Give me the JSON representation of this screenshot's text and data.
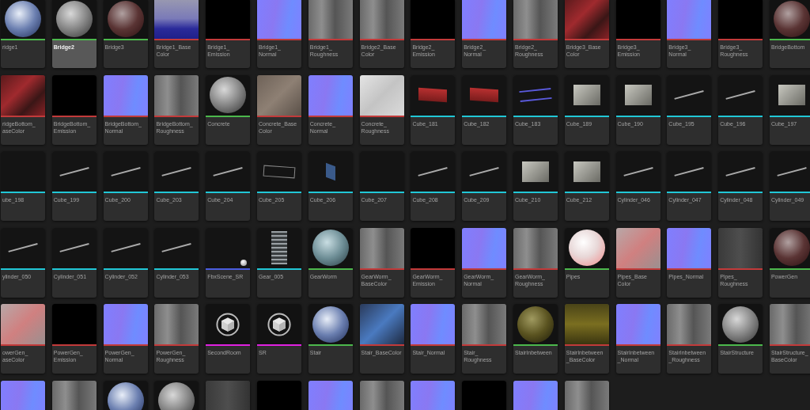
{
  "assets": [
    {
      "label": "ridge1",
      "color": "#4cb84c",
      "kind": "sphere-blue",
      "selected": false
    },
    {
      "label": "Bridge2",
      "color": "#4cb84c",
      "kind": "sphere-grey",
      "selected": true
    },
    {
      "label": "Bridge3",
      "color": "#4cb84c",
      "kind": "sphere-red",
      "selected": false
    },
    {
      "label": "Bridge1_Base\nColor",
      "color": "#c23a3a",
      "kind": "blueprint",
      "selected": false
    },
    {
      "label": "Bridge1_\nEmission",
      "color": "#c23a3a",
      "kind": "black",
      "selected": false
    },
    {
      "label": "Bridge1_\nNormal",
      "color": "#c23a3a",
      "kind": "normal",
      "selected": false
    },
    {
      "label": "Bridge1_\nRoughness",
      "color": "#c23a3a",
      "kind": "grey",
      "selected": false
    },
    {
      "label": "Bridge2_Base\nColor",
      "color": "#c23a3a",
      "kind": "grey",
      "selected": false
    },
    {
      "label": "Bridge2_\nEmission",
      "color": "#c23a3a",
      "kind": "black",
      "selected": false
    },
    {
      "label": "Bridge2_\nNormal",
      "color": "#c23a3a",
      "kind": "normal",
      "selected": false
    },
    {
      "label": "Bridge2_\nRoughness",
      "color": "#c23a3a",
      "kind": "grey",
      "selected": false
    },
    {
      "label": "Bridge3_Base\nColor",
      "color": "#c23a3a",
      "kind": "red",
      "selected": false
    },
    {
      "label": "Bridge3_\nEmission",
      "color": "#c23a3a",
      "kind": "black",
      "selected": false
    },
    {
      "label": "Bridge3_\nNormal",
      "color": "#c23a3a",
      "kind": "normal",
      "selected": false
    },
    {
      "label": "Bridge3_\nRoughness",
      "color": "#c23a3a",
      "kind": "black",
      "selected": false
    },
    {
      "label": "BridgeBottom",
      "color": "#4cb84c",
      "kind": "sphere-red",
      "selected": false
    },
    {
      "label": "ridgeBottom_\naseColor",
      "color": "#c23a3a",
      "kind": "red",
      "selected": false
    },
    {
      "label": "BridgeBottom_\nEmission",
      "color": "#c23a3a",
      "kind": "black",
      "selected": false
    },
    {
      "label": "BridgeBottom_\nNormal",
      "color": "#c23a3a",
      "kind": "normal",
      "selected": false
    },
    {
      "label": "BridgeBottom_\nRoughness",
      "color": "#c23a3a",
      "kind": "grey",
      "selected": false
    },
    {
      "label": "Concrete",
      "color": "#4cb84c",
      "kind": "sphere-grey",
      "selected": false
    },
    {
      "label": "Concrete_Base\nColor",
      "color": "#c23a3a",
      "kind": "brown",
      "selected": false
    },
    {
      "label": "Concrete_\nNormal",
      "color": "#c23a3a",
      "kind": "normal",
      "selected": false
    },
    {
      "label": "Concrete_\nRoughness",
      "color": "#c23a3a",
      "kind": "light",
      "selected": false
    },
    {
      "label": "Cube_181",
      "color": "#21c7d6",
      "kind": "mesh-red",
      "selected": false
    },
    {
      "label": "Cube_182",
      "color": "#21c7d6",
      "kind": "mesh-red",
      "selected": false
    },
    {
      "label": "Cube_183",
      "color": "#21c7d6",
      "kind": "mesh-rail",
      "selected": false
    },
    {
      "label": "Cube_189",
      "color": "#21c7d6",
      "kind": "mesh-box",
      "selected": false
    },
    {
      "label": "Cube_190",
      "color": "#21c7d6",
      "kind": "mesh-box",
      "selected": false
    },
    {
      "label": "Cube_195",
      "color": "#21c7d6",
      "kind": "mesh-line",
      "selected": false
    },
    {
      "label": "Cube_196",
      "color": "#21c7d6",
      "kind": "mesh-line",
      "selected": false
    },
    {
      "label": "Cube_197",
      "color": "#21c7d6",
      "kind": "mesh-box",
      "selected": false
    },
    {
      "label": "ube_198",
      "color": "#21c7d6",
      "kind": "mesh-empty",
      "selected": false
    },
    {
      "label": "Cube_199",
      "color": "#21c7d6",
      "kind": "mesh-line",
      "selected": false
    },
    {
      "label": "Cube_200",
      "color": "#21c7d6",
      "kind": "mesh-line",
      "selected": false
    },
    {
      "label": "Cube_203",
      "color": "#21c7d6",
      "kind": "mesh-line",
      "selected": false
    },
    {
      "label": "Cube_204",
      "color": "#21c7d6",
      "kind": "mesh-line",
      "selected": false
    },
    {
      "label": "Cube_205",
      "color": "#21c7d6",
      "kind": "mesh-frame",
      "selected": false
    },
    {
      "label": "Cube_206",
      "color": "#21c7d6",
      "kind": "mesh-panel",
      "selected": false
    },
    {
      "label": "Cube_207",
      "color": "#21c7d6",
      "kind": "mesh-empty",
      "selected": false
    },
    {
      "label": "Cube_208",
      "color": "#21c7d6",
      "kind": "mesh-line",
      "selected": false
    },
    {
      "label": "Cube_209",
      "color": "#21c7d6",
      "kind": "mesh-line",
      "selected": false
    },
    {
      "label": "Cube_210",
      "color": "#21c7d6",
      "kind": "mesh-box",
      "selected": false
    },
    {
      "label": "Cube_212",
      "color": "#21c7d6",
      "kind": "mesh-box",
      "selected": false
    },
    {
      "label": "Cylinder_046",
      "color": "#21c7d6",
      "kind": "mesh-line",
      "selected": false
    },
    {
      "label": "Cylinder_047",
      "color": "#21c7d6",
      "kind": "mesh-line",
      "selected": false
    },
    {
      "label": "Cylinder_048",
      "color": "#21c7d6",
      "kind": "mesh-line",
      "selected": false
    },
    {
      "label": "Cylinder_049",
      "color": "#21c7d6",
      "kind": "mesh-line",
      "selected": false
    },
    {
      "label": "ylinder_050",
      "color": "#21c7d6",
      "kind": "mesh-line",
      "selected": false
    },
    {
      "label": "Cylinder_051",
      "color": "#21c7d6",
      "kind": "mesh-line",
      "selected": false
    },
    {
      "label": "Cylinder_052",
      "color": "#21c7d6",
      "kind": "mesh-line",
      "selected": false
    },
    {
      "label": "Cylinder_053",
      "color": "#21c7d6",
      "kind": "mesh-line",
      "selected": false
    },
    {
      "label": "FbxScene_SR",
      "color": "#4a5de0",
      "kind": "scene",
      "selected": false
    },
    {
      "label": "Gear_005",
      "color": "#21c7d6",
      "kind": "mesh-tower",
      "selected": false
    },
    {
      "label": "GearWorm",
      "color": "#4cb84c",
      "kind": "sphere-teal",
      "selected": false
    },
    {
      "label": "GearWorm_\nBaseColor",
      "color": "#c23a3a",
      "kind": "grey",
      "selected": false
    },
    {
      "label": "GearWorm_\nEmission",
      "color": "#c23a3a",
      "kind": "black",
      "selected": false
    },
    {
      "label": "GearWorm_\nNormal",
      "color": "#c23a3a",
      "kind": "normal",
      "selected": false
    },
    {
      "label": "GearWorm_\nRoughness",
      "color": "#c23a3a",
      "kind": "grey",
      "selected": false
    },
    {
      "label": "Pipes",
      "color": "#4cb84c",
      "kind": "sphere-pink",
      "selected": false
    },
    {
      "label": "Pipes_Base\nColor",
      "color": "#c23a3a",
      "kind": "pinkgrey",
      "selected": false
    },
    {
      "label": "Pipes_Normal",
      "color": "#c23a3a",
      "kind": "normal",
      "selected": false
    },
    {
      "label": "Pipes_\nRoughness",
      "color": "#c23a3a",
      "kind": "dark",
      "selected": false
    },
    {
      "label": "PowerGen",
      "color": "#4cb84c",
      "kind": "sphere-red",
      "selected": false
    },
    {
      "label": "owerGen_\naseColor",
      "color": "#c23a3a",
      "kind": "pinkgrey",
      "selected": false
    },
    {
      "label": "PowerGen_\nEmission",
      "color": "#c23a3a",
      "kind": "black",
      "selected": false
    },
    {
      "label": "PowerGen_\nNormal",
      "color": "#c23a3a",
      "kind": "normal",
      "selected": false
    },
    {
      "label": "PowerGen_\nRoughness",
      "color": "#c23a3a",
      "kind": "grey",
      "selected": false
    },
    {
      "label": "SecondRoom",
      "color": "#e021e0",
      "kind": "level",
      "selected": false
    },
    {
      "label": "SR",
      "color": "#e021e0",
      "kind": "level",
      "selected": false
    },
    {
      "label": "Stair",
      "color": "#4cb84c",
      "kind": "sphere-blue",
      "selected": false
    },
    {
      "label": "Stair_BaseColor",
      "color": "#c23a3a",
      "kind": "bluegrey",
      "selected": false
    },
    {
      "label": "Stair_Normal",
      "color": "#c23a3a",
      "kind": "normal",
      "selected": false
    },
    {
      "label": "Stair_\nRoughness",
      "color": "#c23a3a",
      "kind": "grey",
      "selected": false
    },
    {
      "label": "StairInbetween",
      "color": "#4cb84c",
      "kind": "sphere-yellow",
      "selected": false
    },
    {
      "label": "StairInbetween\n_BaseColor",
      "color": "#c23a3a",
      "kind": "olive",
      "selected": false
    },
    {
      "label": "StairInbetween\n_Normal",
      "color": "#c23a3a",
      "kind": "normal",
      "selected": false
    },
    {
      "label": "StairInbetween\n_Roughness",
      "color": "#c23a3a",
      "kind": "grey",
      "selected": false
    },
    {
      "label": "StairStructure",
      "color": "#4cb84c",
      "kind": "sphere-grey",
      "selected": false
    },
    {
      "label": "StairStructure_\nBaseColor",
      "color": "#c23a3a",
      "kind": "grey",
      "selected": false
    },
    {
      "kind": "normal"
    },
    {
      "kind": "grey"
    },
    {
      "kind": "sphere-blue"
    },
    {
      "kind": "sphere-grey"
    },
    {
      "kind": "dark"
    },
    {
      "kind": "black"
    },
    {
      "kind": "normal"
    },
    {
      "kind": "grey"
    },
    {
      "kind": "normal"
    },
    {
      "kind": "black"
    },
    {
      "kind": "normal"
    },
    {
      "kind": "grey"
    }
  ]
}
